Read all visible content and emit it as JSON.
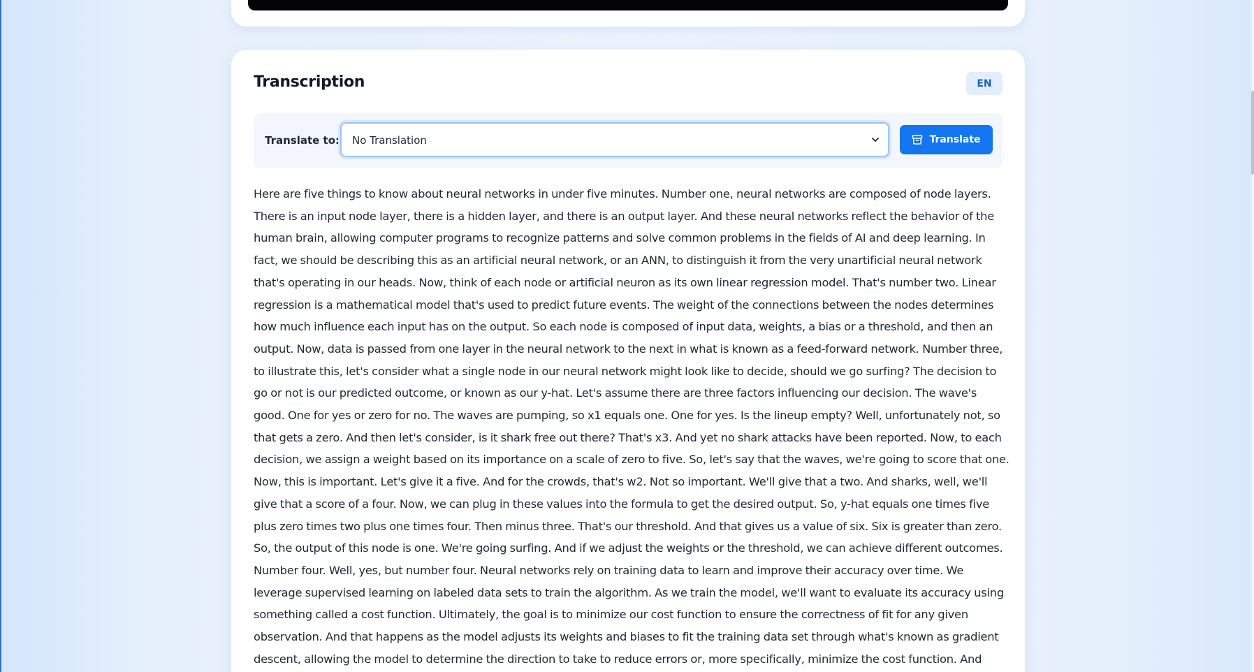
{
  "video": {},
  "transcription": {
    "title": "Transcription",
    "language_badge": "EN",
    "translate": {
      "label": "Translate to:",
      "selected": "No Translation",
      "button_label": "Translate",
      "button_icon": "archive-box-icon"
    },
    "text": "Here are five things to know about neural networks in under five minutes. Number one, neural networks are composed of node layers. There is an input node layer, there is a hidden layer, and there is an output layer. And these neural networks reflect the behavior of the human brain, allowing computer programs to recognize patterns and solve common problems in the fields of AI and deep learning. In fact, we should be describing this as an artificial neural network, or an ANN, to distinguish it from the very unartificial neural network that's operating in our heads. Now, think of each node or artificial neuron as its own linear regression model. That's number two. Linear regression is a mathematical model that's used to predict future events. The weight of the connections between the nodes determines how much influence each input has on the output. So each node is composed of input data, weights, a bias or a threshold, and then an output. Now, data is passed from one layer in the neural network to the next in what is known as a feed-forward network. Number three, to illustrate this, let's consider what a single node in our neural network might look like to decide, should we go surfing? The decision to go or not is our predicted outcome, or known as our y-hat. Let's assume there are three factors influencing our decision. The wave's good. One for yes or zero for no. The waves are pumping, so x1 equals one. One for yes. Is the lineup empty? Well, unfortunately not, so that gets a zero. And then let's consider, is it shark free out there? That's x3. And yet no shark attacks have been reported. Now, to each decision, we assign a weight based on its importance on a scale of zero to five. So, let's say that the waves, we're going to score that one. Now, this is important. Let's give it a five. And for the crowds, that's w2. Not so important. We'll give that a two. And sharks, well, we'll give that a score of a four. Now, we can plug in these values into the formula to get the desired output. So, y-hat equals one times five plus zero times two plus one times four. Then minus three. That's our threshold. And that gives us a value of six. Six is greater than zero. So, the output of this node is one. We're going surfing. And if we adjust the weights or the threshold, we can achieve different outcomes. Number four. Well, yes, but number four. Neural networks rely on training data to learn and improve their accuracy over time. We leverage supervised learning on labeled data sets to train the algorithm. As we train the model, we'll want to evaluate its accuracy using something called a cost function. Ultimately, the goal is to minimize our cost function to ensure the correctness of fit for any given observation. And that happens as the model adjusts its weights and biases to fit the training data set through what's known as gradient descent, allowing the model to determine the direction to take to reduce errors or, more specifically, minimize the cost function. And then, finally, number five. There are multiple"
  },
  "colors": {
    "accent": "#1375ef",
    "badge_bg": "#e3eefc",
    "badge_text": "#1b60c9",
    "page_bg": "#e6f0fc"
  }
}
